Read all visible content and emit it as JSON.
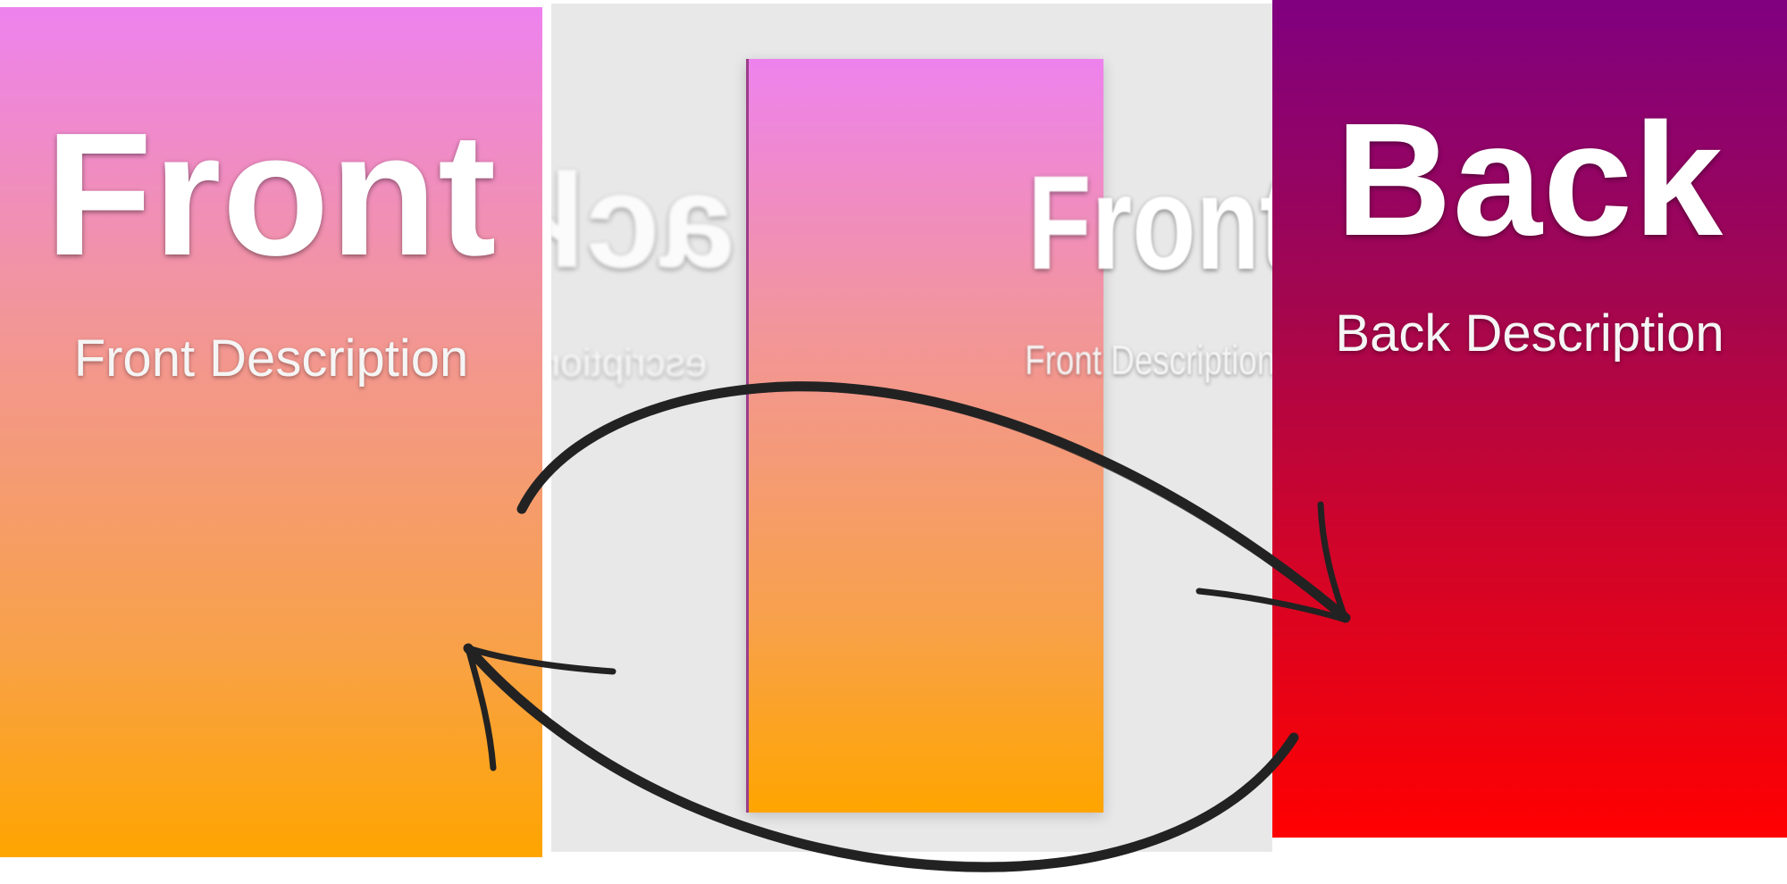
{
  "front_card": {
    "title": "Front",
    "description": "Front Description",
    "gradient_colors": [
      "#ee82ee",
      "#ffa500"
    ]
  },
  "flip_state": {
    "ghost_back_title": "ack",
    "ghost_back_description": "escription",
    "front_title": "Front",
    "front_description": "Front Description",
    "background_color": "#e8e8e8"
  },
  "back_card": {
    "title": "Back",
    "description": "Back Description",
    "gradient_colors": [
      "#800080",
      "#ff0000"
    ]
  },
  "arrows": {
    "top_arrow_direction": "front-to-back",
    "bottom_arrow_direction": "back-to-front",
    "color": "#222222"
  }
}
